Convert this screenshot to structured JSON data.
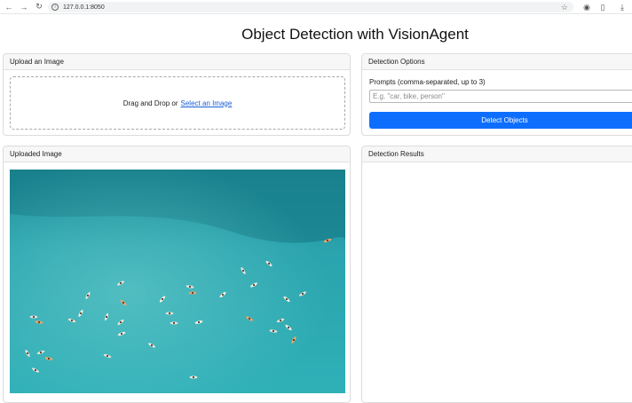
{
  "browser": {
    "url": "127.0.0.1:8050",
    "icons": [
      "back-icon",
      "forward-icon",
      "reload-icon",
      "site-info-icon",
      "bookmark-star-icon",
      "extension-icon",
      "puzzle-icon",
      "download-icon"
    ]
  },
  "app": {
    "title": "Object Detection with VisionAgent"
  },
  "upload": {
    "header": "Upload an Image",
    "drop_text": "Drag and Drop or",
    "select_link": "Select an Image"
  },
  "options": {
    "header": "Detection Options",
    "prompt_label": "Prompts (comma-separated, up to 3)",
    "prompt_placeholder": "E.g. \"car, bike, person\"",
    "detect_button": "Detect Objects"
  },
  "uploaded": {
    "header": "Uploaded Image"
  },
  "results": {
    "header": "Detection Results"
  },
  "colors": {
    "accent": "#0d6efd",
    "link": "#1a5fd6",
    "water_deep": "#1d8d9a",
    "water_light": "#38b3ba"
  }
}
